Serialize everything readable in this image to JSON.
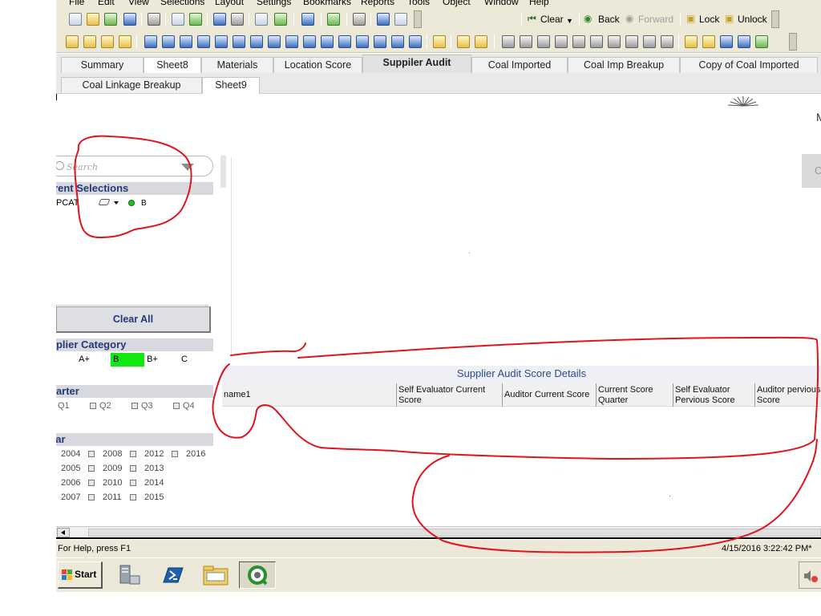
{
  "menu": [
    "File",
    "Edit",
    "View",
    "Selections",
    "Layout",
    "Settings",
    "Bookmarks",
    "Reports",
    "Tools",
    "Object",
    "Window",
    "Help"
  ],
  "toolbar": {
    "clear_label": "Clear",
    "back_label": "Back",
    "forward_label": "Forward",
    "lock_label": "Lock",
    "unlock_label": "Unlock"
  },
  "tabs_row1": [
    "Summary",
    "Sheet8",
    "Materials",
    "Location Score",
    "Suppiler Audit",
    "Coal Imported",
    "Coal Imp Breakup",
    "Copy of Coal Imported"
  ],
  "tabs_row2": [
    "Coal Linkage Breakup",
    "Sheet9"
  ],
  "sidebar": {
    "search_placeholder": "Search",
    "current_selections": {
      "title": "rrent Selections",
      "field": "PCAT",
      "value": "B"
    },
    "clear_all": "Clear All",
    "supplier_category": {
      "title": "pplier Category",
      "options": [
        "A+",
        "B",
        "B+",
        "C"
      ],
      "selected": "B"
    },
    "quarter": {
      "title": "uarter",
      "options": [
        "Q1",
        "Q2",
        "Q3",
        "Q4"
      ]
    },
    "year": {
      "title": "ear",
      "col1": [
        "2004",
        "2005",
        "2006",
        "2007"
      ],
      "col2": [
        "2008",
        "2009",
        "2010",
        "2011"
      ],
      "col3": [
        "2012",
        "2013",
        "2014",
        "2015"
      ],
      "col4": [
        "2016"
      ]
    }
  },
  "table": {
    "title": "Supplier Audit Score Details",
    "columns": [
      "name1",
      "Self Evaluator Current Score",
      "Auditor Current Score",
      "Current Score Quarter",
      "Self Evaluator Pervious Score",
      "Auditor pervious Score"
    ]
  },
  "edge": {
    "letter": "M",
    "button_letter": "C"
  },
  "status": {
    "help": "For Help, press F1",
    "timestamp": "4/15/2016 3:22:42 PM*"
  },
  "taskbar": {
    "start_label": "Start"
  },
  "colors": {
    "selected_category": "#10e810",
    "header_text": "#24387a",
    "annotation_red": "#e0141e"
  }
}
